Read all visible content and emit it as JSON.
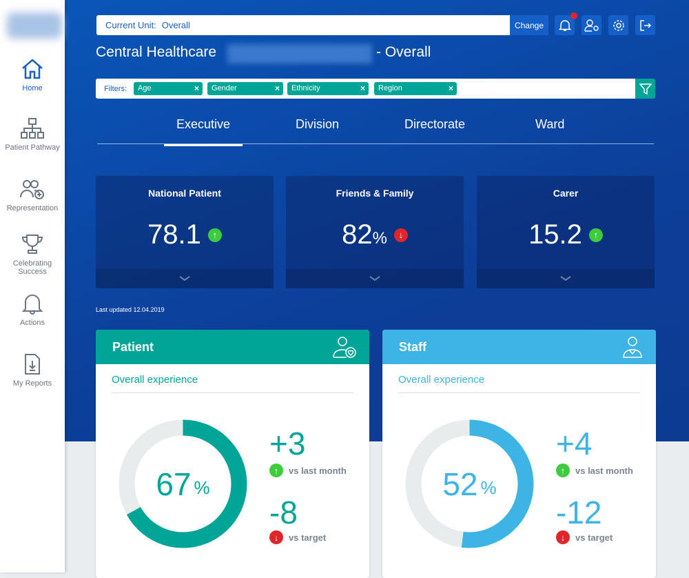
{
  "sidebar": {
    "items": [
      {
        "label": "Home",
        "icon": "home-icon"
      },
      {
        "label": "Patient Pathway",
        "icon": "hierarchy-icon"
      },
      {
        "label": "Representation",
        "icon": "users-add-icon"
      },
      {
        "label": "Celebrating Success",
        "icon": "trophy-icon"
      },
      {
        "label": "Actions",
        "icon": "bell-icon"
      },
      {
        "label": "My Reports",
        "icon": "report-download-icon"
      }
    ]
  },
  "header": {
    "unit_label": "Current Unit:",
    "unit_value": "Overall",
    "change_label": "Change",
    "title": "Central Healthcare",
    "title_suffix": "- Overall",
    "notification_dot_color": "#e0262a"
  },
  "filters": {
    "label": "Filters:",
    "chips": [
      "Age",
      "Gender",
      "Ethnicity",
      "Region"
    ]
  },
  "tabs": [
    "Executive",
    "Division",
    "Directorate",
    "Ward"
  ],
  "kpis": [
    {
      "title": "National Patient",
      "value": "78.1",
      "unit": "",
      "trend": "up"
    },
    {
      "title": "Friends & Family",
      "value": "82",
      "unit": "%",
      "trend": "down"
    },
    {
      "title": "Carer",
      "value": "15.2",
      "unit": "",
      "trend": "up"
    }
  ],
  "last_updated": "Last updated 12.04.2019",
  "cards": [
    {
      "title": "Patient",
      "subtitle": "Overall experience",
      "percent": 67,
      "percent_text": "67",
      "pct_sign": "%",
      "color": "#00a598",
      "stat1": "+3",
      "stat1_label": "vs last month",
      "stat2": "-8",
      "stat2_label": "vs target"
    },
    {
      "title": "Staff",
      "subtitle": "Overall experience",
      "percent": 52,
      "percent_text": "52",
      "pct_sign": "%",
      "color": "#3db3e6",
      "stat1": "+4",
      "stat1_label": "vs last month",
      "stat2": "-12",
      "stat2_label": "vs target"
    }
  ],
  "colors": {
    "brand_blue": "#0b4fb0",
    "teal": "#00a598",
    "sky": "#3db3e6",
    "up": "#3ccc3c",
    "down": "#e0262a"
  }
}
